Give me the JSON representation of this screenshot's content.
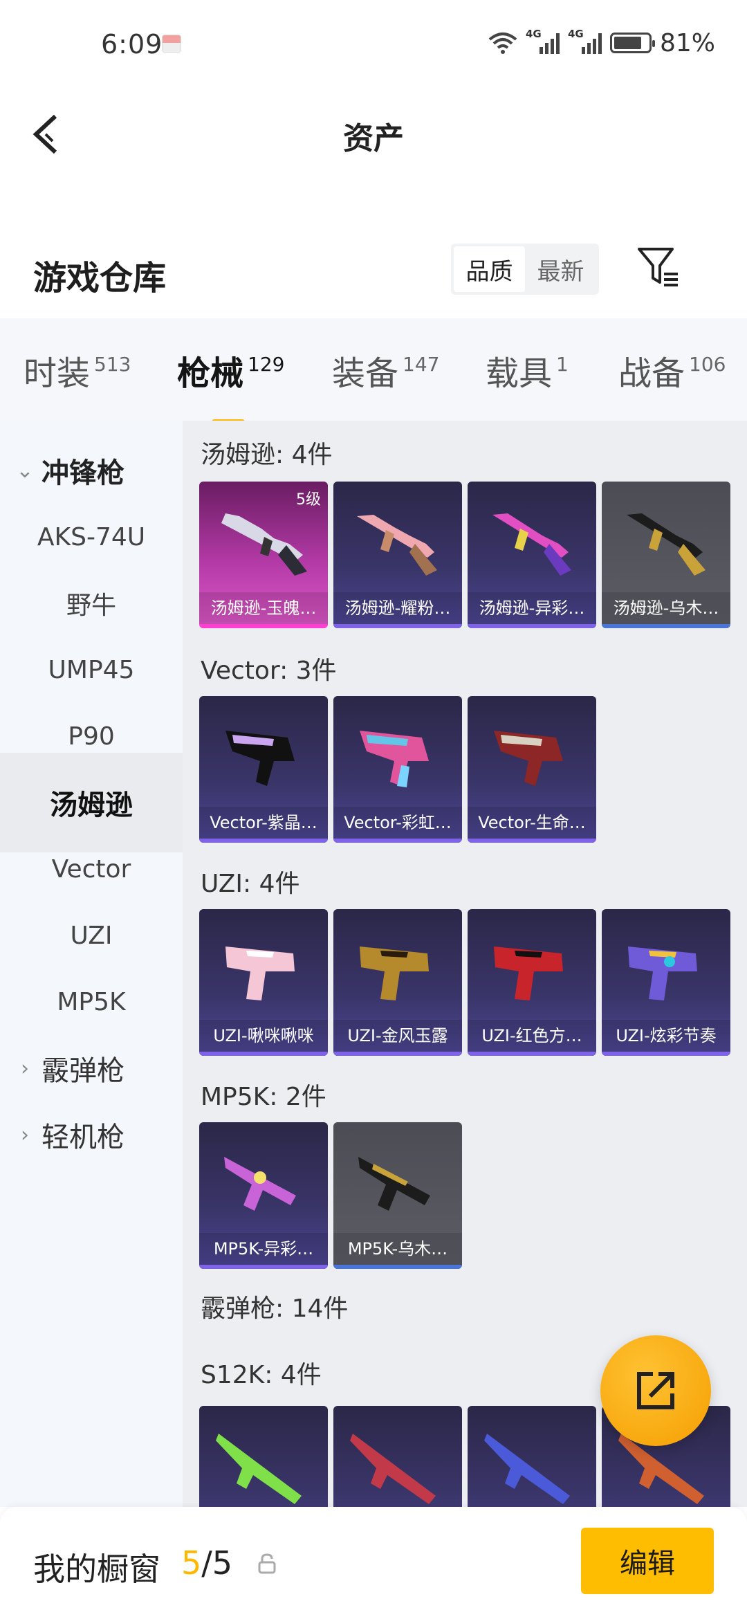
{
  "status_bar": {
    "time": "6:09",
    "battery_percent": "81%",
    "network_tag_1": "4G",
    "network_tag_2": "4G",
    "battery_level": 0.81
  },
  "header": {
    "title": "资产"
  },
  "section": {
    "title": "游戏仓库",
    "sort_options": [
      "品质",
      "最新"
    ],
    "selected_sort": "品质"
  },
  "tabs": [
    {
      "label": "时装",
      "count": "513"
    },
    {
      "label": "枪械",
      "count": "129"
    },
    {
      "label": "装备",
      "count": "147"
    },
    {
      "label": "载具",
      "count": "1"
    },
    {
      "label": "战备",
      "count": "106"
    }
  ],
  "active_tab": "枪械",
  "sidebar": {
    "group_open": "冲锋枪",
    "items": [
      "AKS-74U",
      "野牛",
      "UMP45",
      "P90",
      "汤姆逊",
      "Vector",
      "UZI",
      "MP5K"
    ],
    "active_item": "汤姆逊",
    "groups_collapsed": [
      "霰弹枪",
      "轻机枪"
    ]
  },
  "content": {
    "groups": [
      {
        "title": "汤姆逊: 4件",
        "items": [
          {
            "name": "汤姆逊-玉魄…",
            "level": "5级",
            "rarity": "pink"
          },
          {
            "name": "汤姆逊-耀粉…",
            "rarity": "purple"
          },
          {
            "name": "汤姆逊-异彩…",
            "rarity": "purple"
          },
          {
            "name": "汤姆逊-乌木…",
            "rarity": "grey"
          }
        ]
      },
      {
        "title": "Vector: 3件",
        "items": [
          {
            "name": "Vector-紫晶…",
            "rarity": "purple"
          },
          {
            "name": "Vector-彩虹…",
            "rarity": "purple"
          },
          {
            "name": "Vector-生命…",
            "rarity": "purple"
          }
        ]
      },
      {
        "title": "UZI: 4件",
        "items": [
          {
            "name": "UZI-啾咪啾咪",
            "rarity": "purple"
          },
          {
            "name": "UZI-金风玉露",
            "rarity": "purple"
          },
          {
            "name": "UZI-红色方…",
            "rarity": "purple"
          },
          {
            "name": "UZI-炫彩节奏",
            "rarity": "purple"
          }
        ]
      },
      {
        "title": "MP5K: 2件",
        "items": [
          {
            "name": "MP5K-异彩…",
            "rarity": "purple"
          },
          {
            "name": "MP5K-乌木…",
            "rarity": "grey"
          }
        ]
      },
      {
        "title": "霰弹枪: 14件"
      },
      {
        "title": "S12K: 4件"
      }
    ]
  },
  "bottom_bar": {
    "label": "我的橱窗",
    "count_current": "5",
    "count_total": "/5",
    "edit_label": "编辑"
  },
  "colors": {
    "accent": "#ffb800",
    "pink_rarity": "#de59c9",
    "purple_rarity": "#7e63e6",
    "grey_rarity": "#5d5d66"
  },
  "icons": [
    "back-arrow-icon",
    "filter-icon",
    "lock-icon",
    "share-export-icon",
    "chevron-down-icon",
    "chevron-right-icon",
    "wifi-icon",
    "signal-icon",
    "battery-icon",
    "notification-icon"
  ]
}
